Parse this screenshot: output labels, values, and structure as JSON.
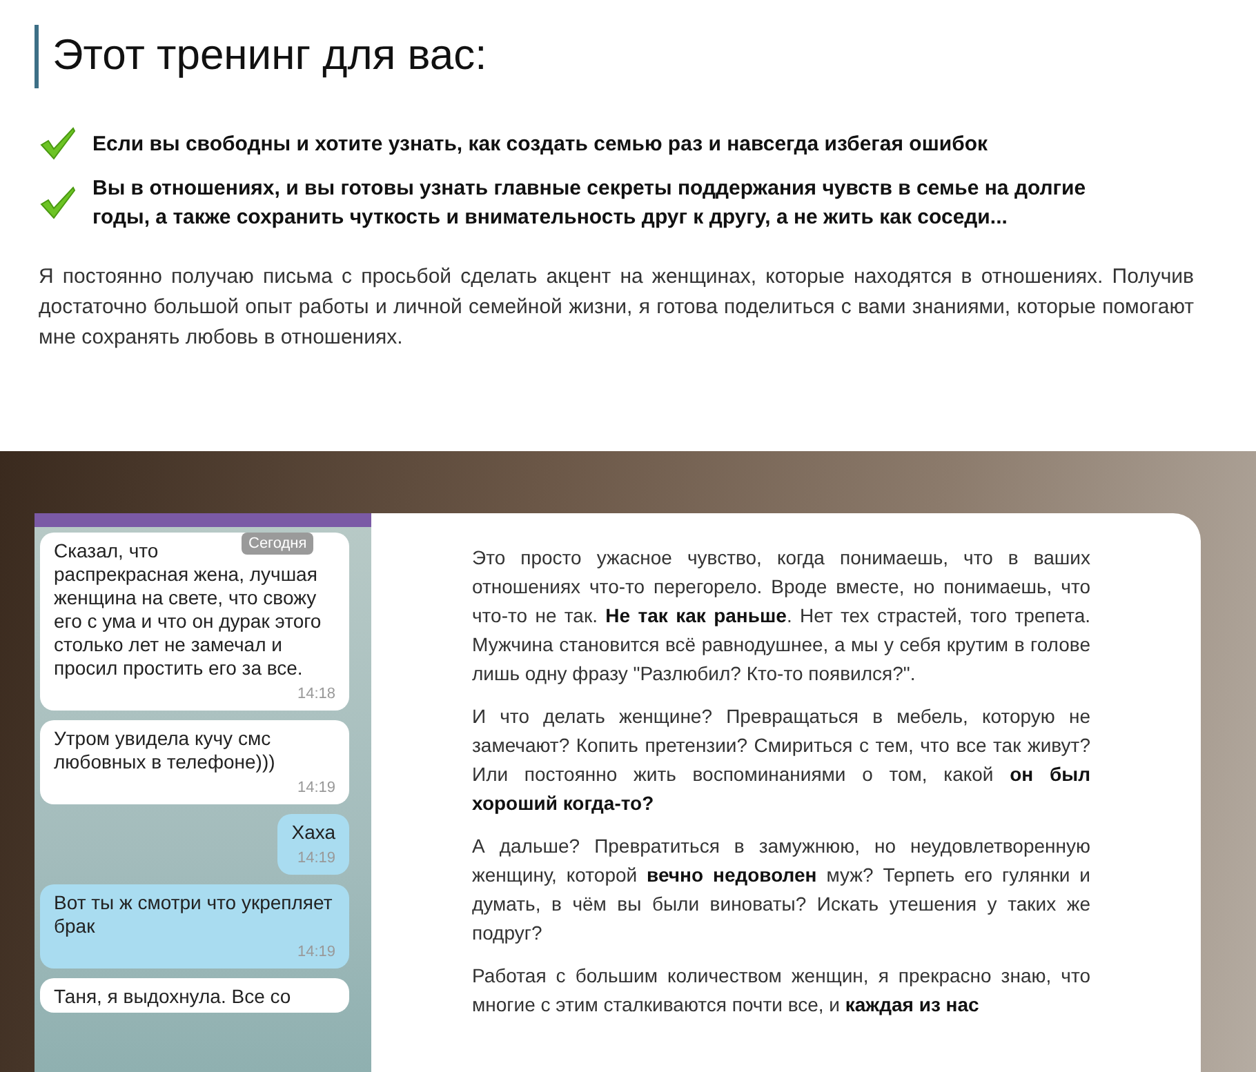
{
  "heading": "Этот тренинг для вас:",
  "checklist": [
    {
      "text": "Если вы свободны и хотите узнать, как создать семью раз и навсегда избегая ошибок",
      "checked": true
    },
    {
      "text": "Вы в отношениях, и вы готовы узнать главные секреты поддержания чувств в семье на долгие годы, а также сохранить чуткость и внимательность друг к другу, а не жить как соседи...",
      "checked": true
    }
  ],
  "intro": "Я постоянно получаю письма с просьбой сделать акцент на женщинах, которые находятся в отношениях. Получив достаточно большой опыт работы и личной семейной жизни, я готова поделиться с вами знаниями, которые помогают мне сохранять любовь в отношениях.",
  "chat": {
    "date_badge": "Сегодня",
    "messages": [
      {
        "kind": "incoming",
        "text": "Сказал, что\nраспрекрасная жена, лучшая женщина на свете, что свожу его с ума и что он дурак этого столько лет не замечал и просил простить его за все.",
        "time": "14:18"
      },
      {
        "kind": "incoming",
        "text": "Утром увидела кучу смс любовных в телефоне)))",
        "time": "14:19"
      },
      {
        "kind": "outgoing",
        "text": "Хаха",
        "time": "14:19"
      },
      {
        "kind": "outgoing",
        "text": "Вот ты ж смотри что укрепляет брак",
        "time": "14:19"
      },
      {
        "kind": "incoming",
        "text": "Таня, я выдохнула. Все со"
      }
    ]
  },
  "article": [
    "Это просто ужасное чувство, когда понимаешь, что в ваших отношениях что-то перегорело. Вроде вместе, но понимаешь, что что-то не так. **Не так как раньше**. Нет тех страстей, того трепета. Мужчина становится всё равнодушнее, а мы у себя крутим в голове лишь одну фразу \"Разлюбил? Кто-то появился?\".",
    "И что делать женщине? Превращаться в мебель, которую не замечают? Копить претензии? Смириться с тем, что все так живут? Или постоянно жить воспоминаниями о том, какой **он был хороший когда-то?**",
    "А дальше? Превратиться в замужнюю, но неудовлетворенную женщину, которой **вечно недоволен** муж? Терпеть его гулянки и думать, в чём вы были виноваты? Искать утешения у таких же подруг?",
    "Работая с большим количеством женщин, я прекрасно знаю, что многие с этим сталкиваются почти все, и **каждая из нас**"
  ]
}
